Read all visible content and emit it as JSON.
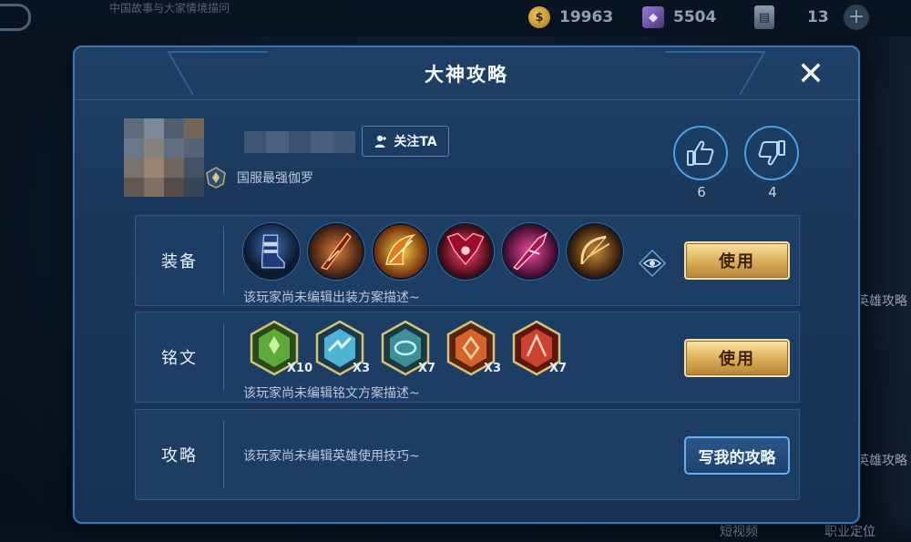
{
  "background": {
    "top_title": "中国故事与大家情境描问",
    "resources": [
      {
        "name": "gold-coin",
        "value": "19963"
      },
      {
        "name": "diamond",
        "value": "5504"
      },
      {
        "name": "ticket",
        "value": "13"
      }
    ],
    "side_labels": [
      "英雄攻略",
      "英雄攻略"
    ],
    "bottom_labels": [
      "短视频",
      "职业定位"
    ]
  },
  "modal": {
    "title": "大神攻略",
    "close_symbol": "✕"
  },
  "user": {
    "follow_label": "关注TA",
    "description": "国服最强伽罗",
    "likes": "6",
    "dislikes": "4"
  },
  "equipment": {
    "label": "装备",
    "description": "该玩家尚未编辑出装方案描述~",
    "use_label": "使用",
    "items": [
      {
        "icon": "boots-icon"
      },
      {
        "icon": "blade-icon"
      },
      {
        "icon": "fire-bow-icon"
      },
      {
        "icon": "demon-wings-icon"
      },
      {
        "icon": "crimson-spear-icon"
      },
      {
        "icon": "golden-bow-icon"
      }
    ]
  },
  "runes": {
    "label": "铭文",
    "description": "该玩家尚未编辑铭文方案描述~",
    "use_label": "使用",
    "items": [
      {
        "icon": "green-rune-icon",
        "qty": "X10",
        "color": "#5fa83a"
      },
      {
        "icon": "cyan-rune-icon",
        "qty": "X3",
        "color": "#4fb3d6"
      },
      {
        "icon": "teal-rune-icon",
        "qty": "X7",
        "color": "#3e8f9a"
      },
      {
        "icon": "orange-rune-icon",
        "qty": "X3",
        "color": "#d4642a"
      },
      {
        "icon": "red-rune-icon",
        "qty": "X7",
        "color": "#c9432e"
      }
    ]
  },
  "guide": {
    "label": "攻略",
    "description": "该玩家尚未编辑英雄使用技巧~",
    "write_label": "写我的攻略"
  },
  "colors": {
    "accent_gold": "#d9ac55",
    "panel_blue": "#1e4066",
    "border_blue": "#3b74ad"
  }
}
